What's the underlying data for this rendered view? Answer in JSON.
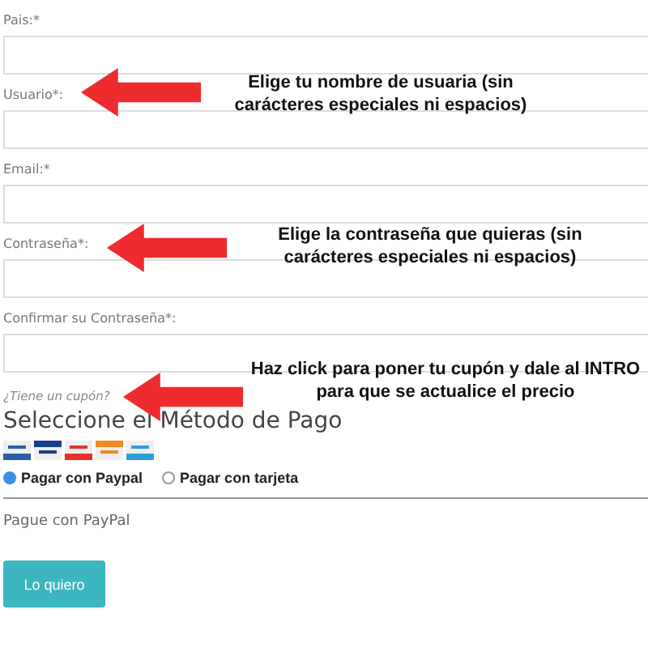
{
  "fields": [
    {
      "label": "Pais:*"
    },
    {
      "label": "Usuario*:"
    },
    {
      "label": "Email:*"
    },
    {
      "label": "Contraseña*:"
    },
    {
      "label": "Confirmar su Contraseña*:"
    }
  ],
  "coupon_link": "¿Tiene un cupón?",
  "payment": {
    "heading": "Seleccione el Método de Pago",
    "cards": [
      {
        "color": "#2a5fa8"
      },
      {
        "color": "#1a3f8f"
      },
      {
        "color": "#e8302a"
      },
      {
        "color": "#f08a24"
      },
      {
        "color": "#2c9fd9"
      }
    ],
    "options": [
      {
        "label": "Pagar con Paypal",
        "selected": true
      },
      {
        "label": "Pagar con tarjeta",
        "selected": false
      }
    ],
    "note": "Pague con PayPal",
    "button": "Lo quiero"
  },
  "annotations": [
    {
      "text": "Elige tu nombre de usuaria (sin carácteres especiales ni espacios)"
    },
    {
      "text": "Elige la contraseña que quieras (sin carácteres especiales ni espacios)"
    },
    {
      "text": "Haz click para poner tu cupón y dale al INTRO para que se actualice el precio"
    }
  ]
}
